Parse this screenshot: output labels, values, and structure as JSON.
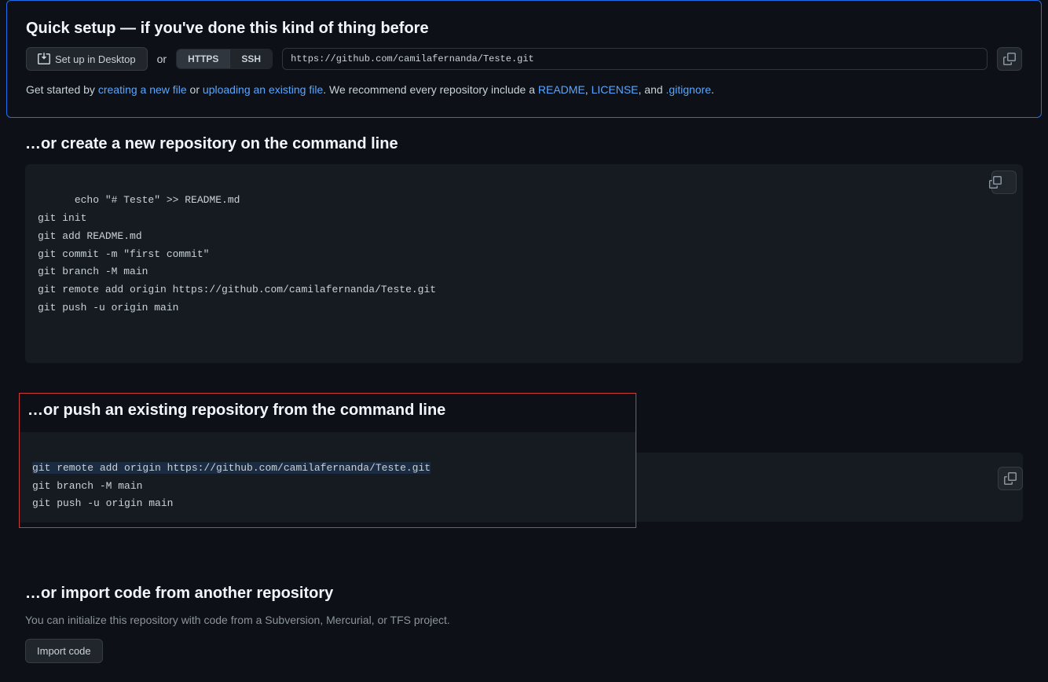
{
  "quicksetup": {
    "title": "Quick setup — if you've done this kind of thing before",
    "desktop_btn": "Set up in Desktop",
    "or": "or",
    "https_tab": "HTTPS",
    "ssh_tab": "SSH",
    "clone_url": "https://github.com/camilafernanda/Teste.git",
    "start_prefix": "Get started by ",
    "link_newfile": "creating a new file",
    "mid_or": " or ",
    "link_upload": "uploading an existing file",
    "after_upload": ". We recommend every repository include a ",
    "link_readme": "README",
    "comma": ", ",
    "link_license": "LICENSE",
    "and_text": ", and ",
    "link_gitignore": ".gitignore",
    "period": "."
  },
  "create_cli": {
    "title": "…or create a new repository on the command line",
    "code": "echo \"# Teste\" >> README.md\ngit init\ngit add README.md\ngit commit -m \"first commit\"\ngit branch -M main\ngit remote add origin https://github.com/camilafernanda/Teste.git\ngit push -u origin main"
  },
  "push_cli": {
    "title": "…or push an existing repository from the command line",
    "line1": "git remote add origin https://github.com/camilafernanda/Teste.git",
    "line2": "git branch -M main",
    "line3": "git push -u origin main"
  },
  "import": {
    "title": "…or import code from another repository",
    "desc": "You can initialize this repository with code from a Subversion, Mercurial, or TFS project.",
    "btn": "Import code"
  }
}
